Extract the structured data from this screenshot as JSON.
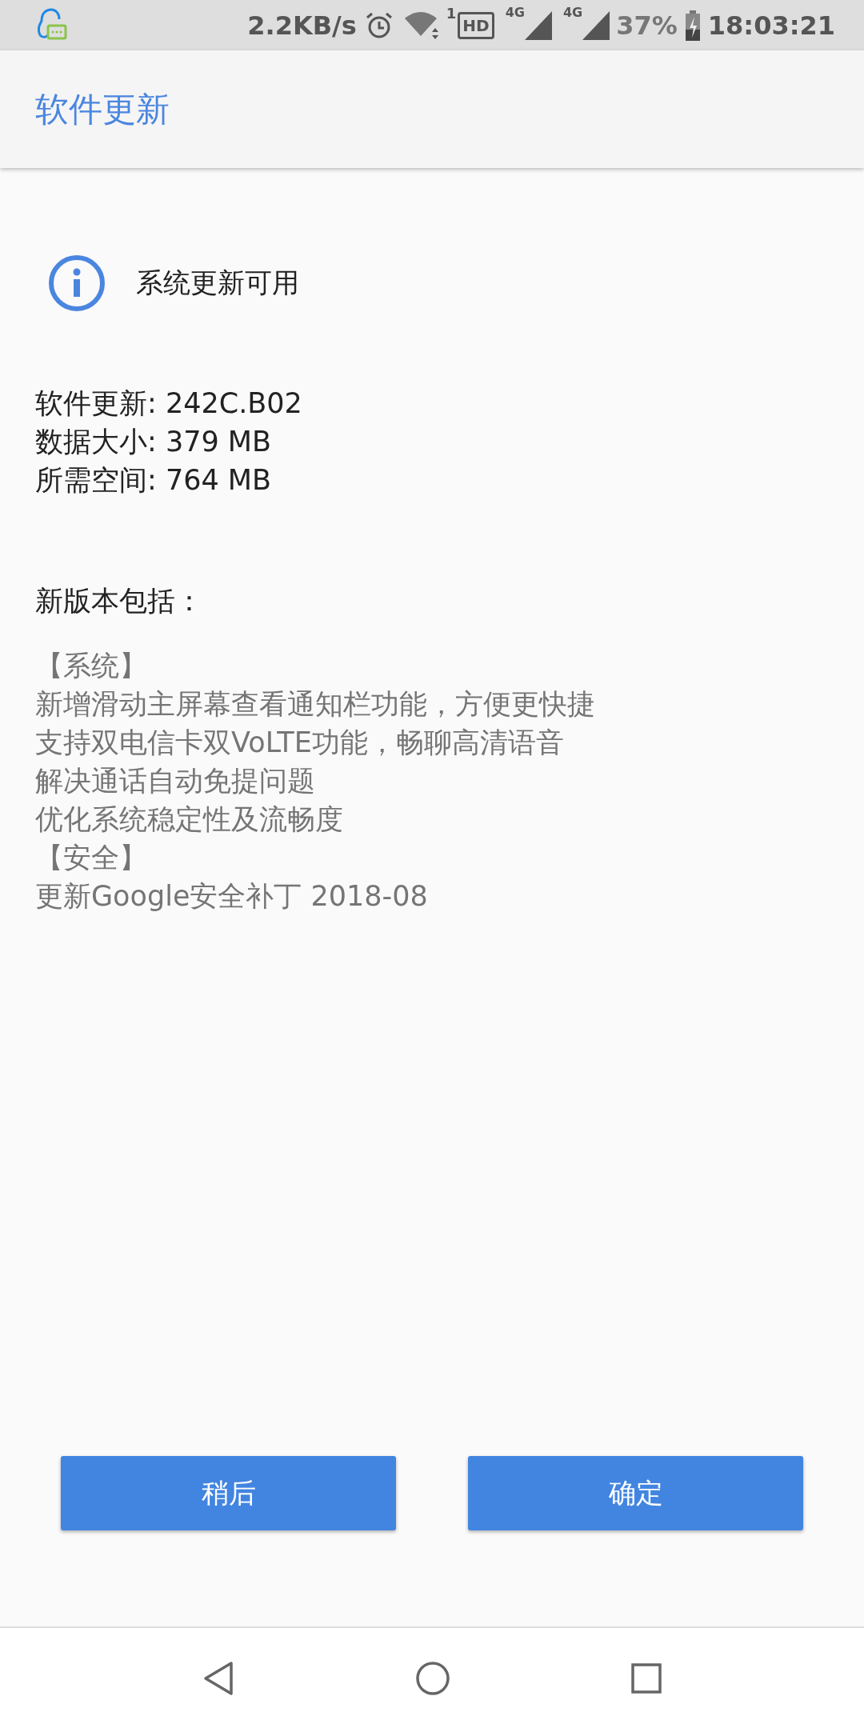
{
  "status_bar": {
    "speed": "2.2KB/s",
    "sim_slot": "1",
    "hd": "HD",
    "networks": [
      "4G",
      "4G"
    ],
    "battery": "37%",
    "time": "18:03:21"
  },
  "app_bar": {
    "title": "软件更新"
  },
  "notice": {
    "text": "系统更新可用"
  },
  "details": [
    "软件更新: 242C.B02",
    "数据大小: 379 MB",
    "所需空间: 764 MB"
  ],
  "changelog": {
    "heading": "新版本包括：",
    "lines": [
      "【系统】",
      "新增滑动主屏幕查看通知栏功能，方便更快捷",
      "支持双电信卡双VoLTE功能，畅聊高清语音",
      "解决通话自动免提问题",
      "优化系统稳定性及流畅度",
      "【安全】",
      "更新Google安全补丁 2018-08"
    ]
  },
  "buttons": [
    {
      "label": "稍后"
    },
    {
      "label": "确定"
    }
  ]
}
